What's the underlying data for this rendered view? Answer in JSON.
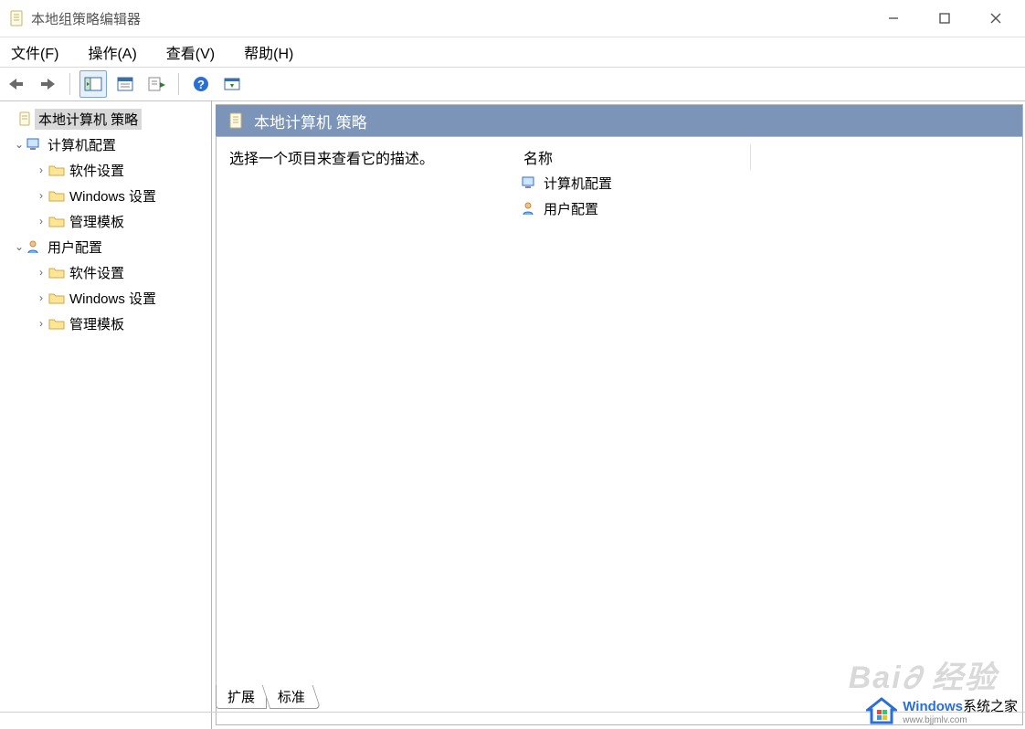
{
  "window": {
    "title": "本地组策略编辑器"
  },
  "menu": {
    "file": "文件(F)",
    "action": "操作(A)",
    "view": "查看(V)",
    "help": "帮助(H)"
  },
  "tree": {
    "root": "本地计算机 策略",
    "comp": "计算机配置",
    "user": "用户配置",
    "soft": "软件设置",
    "win": "Windows 设置",
    "admin": "管理模板"
  },
  "content": {
    "header": "本地计算机 策略",
    "prompt": "选择一个项目来查看它的描述。",
    "col_name": "名称",
    "items": {
      "comp": "计算机配置",
      "user": "用户配置"
    }
  },
  "tabs": {
    "ext": "扩展",
    "std": "标准"
  },
  "watermark": {
    "brand": "Windows",
    "suffix": "系统之家",
    "url": "www.bjjmlv.com"
  }
}
